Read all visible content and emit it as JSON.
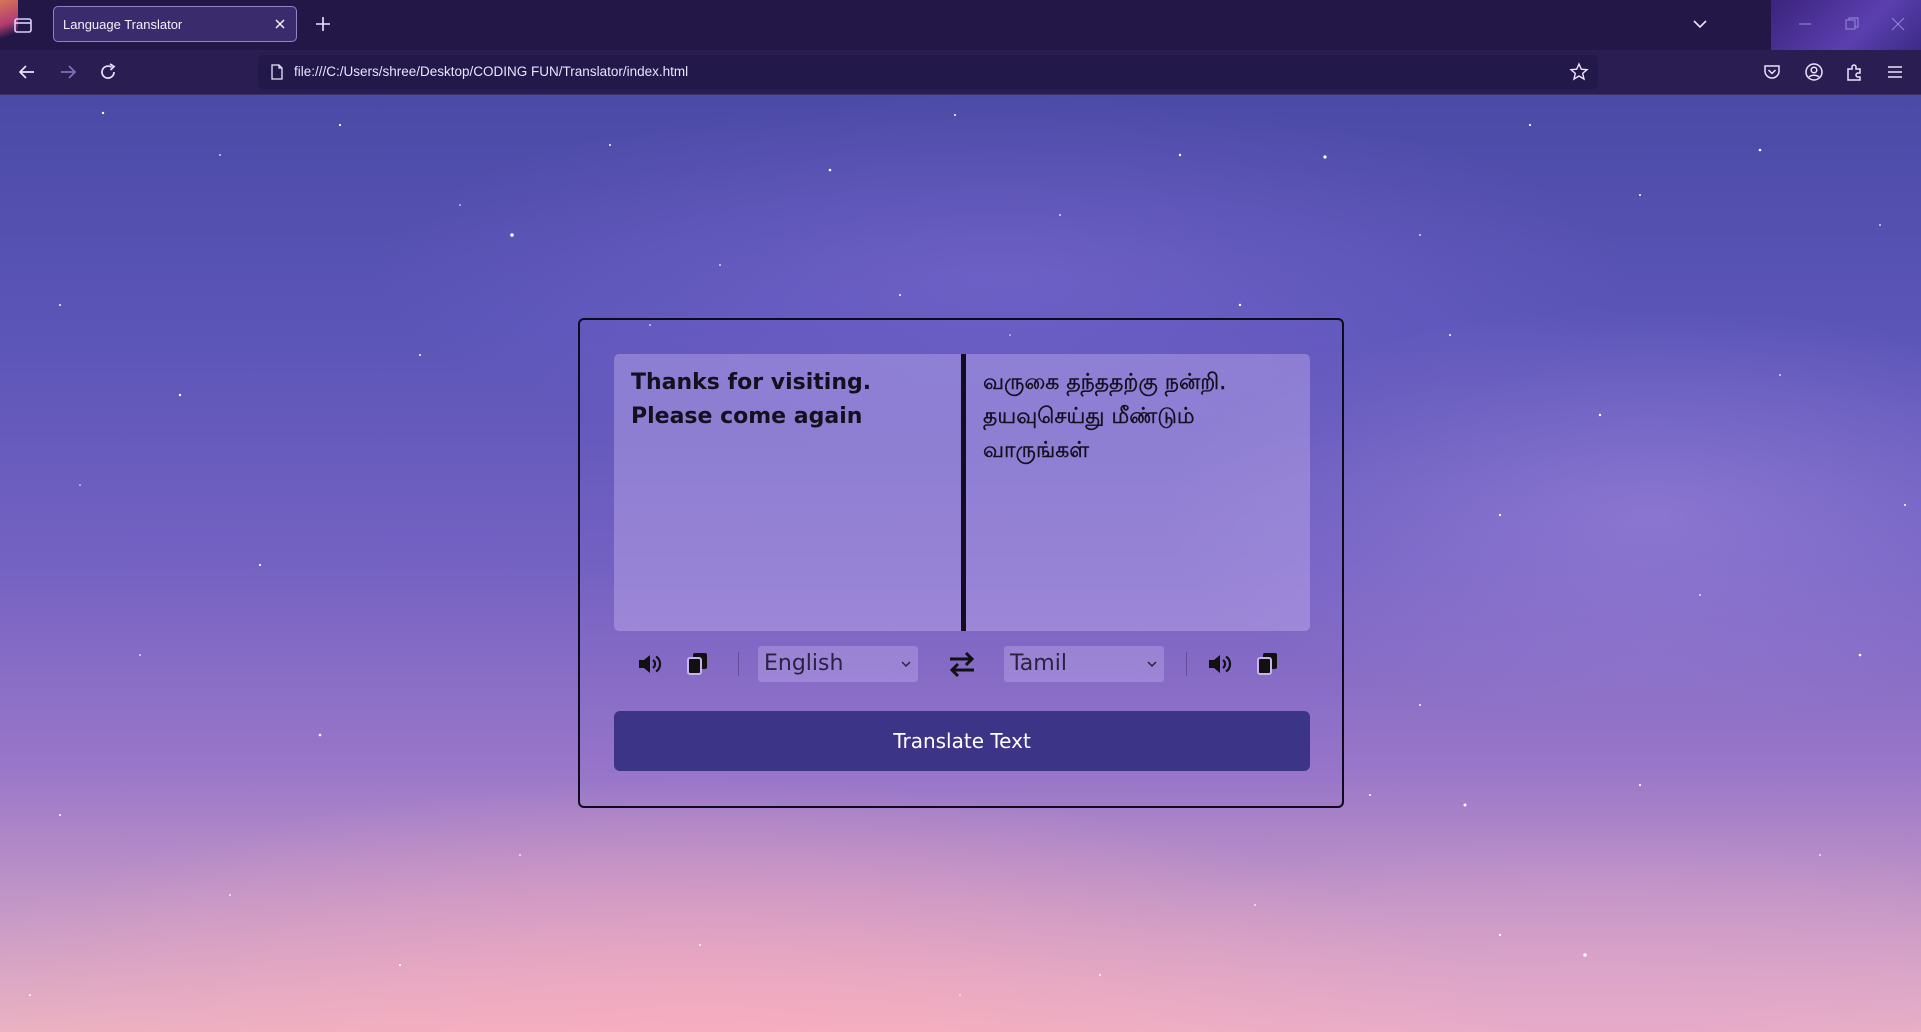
{
  "browser": {
    "tab_title": "Language Translator",
    "url": "file:///C:/Users/shree/Desktop/CODING FUN/Translator/index.html"
  },
  "translator": {
    "from_text": "Thanks for visiting. Please come again",
    "to_text": "வருகை தந்ததற்கு நன்றி. தயவுசெய்து மீண்டும் வாருங்கள்",
    "from_language": "English",
    "to_language": "Tamil",
    "button_label": "Translate Text"
  },
  "icons": {
    "speaker": "speaker-icon",
    "copy": "copy-icon",
    "swap": "swap-arrows-icon"
  },
  "colors": {
    "button": "#3c3587",
    "text_area": "#d7c3fa",
    "border": "#0e0b1c"
  }
}
